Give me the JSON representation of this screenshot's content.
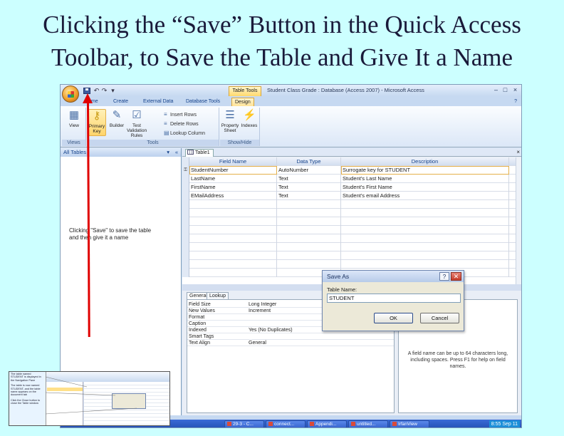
{
  "slide": {
    "title_line1": "Clicking the “Save” Button in the Quick Access",
    "title_line2": "Toolbar, to Save the Table and Give It a Name",
    "annotation": "Clicking \"Save\" to save the table and then give it a name"
  },
  "window": {
    "title": "Student Class Grade : Database (Access 2007) - Microsoft Access",
    "contextual_tab_group": "Table Tools",
    "controls": {
      "minimize": "–",
      "maximize": "□",
      "close": "×"
    },
    "help": "?"
  },
  "ribbon": {
    "tabs": [
      {
        "label": "Home"
      },
      {
        "label": "Create"
      },
      {
        "label": "External Data"
      },
      {
        "label": "Database Tools"
      },
      {
        "label": "Design",
        "active": true
      }
    ],
    "groups": {
      "views": {
        "label": "Views",
        "view_button": "View"
      },
      "tools": {
        "label": "Tools",
        "primary_key": "Primary Key",
        "builder": "Builder",
        "test_validation": "Test Validation Rules",
        "insert_rows": "Insert Rows",
        "delete_rows": "Delete Rows",
        "lookup_column": "Lookup Column"
      },
      "show_hide": {
        "label": "Show/Hide",
        "property_sheet": "Property Sheet",
        "indexes": "Indexes"
      }
    }
  },
  "nav_pane": {
    "header": "All Tables",
    "dropdown": "▾",
    "collapse": "«"
  },
  "document": {
    "tab_label": "Table1",
    "close": "×",
    "columns": [
      "Field Name",
      "Data Type",
      "Description"
    ],
    "rows": [
      {
        "field": "StudentNumber",
        "type": "AutoNumber",
        "desc": "Surrogate key for STUDENT",
        "key": "⚿"
      },
      {
        "field": "LastName",
        "type": "Text",
        "desc": "Student's Last Name"
      },
      {
        "field": "FirstName",
        "type": "Text",
        "desc": "Student's First Name"
      },
      {
        "field": "EMailAddress",
        "type": "Text",
        "desc": "Student's email Address"
      }
    ],
    "field_properties_title": "Field Properties",
    "property_tabs": [
      "General",
      "Lookup"
    ],
    "properties": [
      {
        "k": "Field Size",
        "v": "Long Integer"
      },
      {
        "k": "New Values",
        "v": "Increment"
      },
      {
        "k": "Format",
        "v": ""
      },
      {
        "k": "Caption",
        "v": ""
      },
      {
        "k": "Indexed",
        "v": "Yes (No Duplicates)"
      },
      {
        "k": "Smart Tags",
        "v": ""
      },
      {
        "k": "Text Align",
        "v": "General"
      }
    ],
    "help_text": "A field name can be up to 64 characters long, including spaces. Press F1 for help on field names."
  },
  "dialog": {
    "title": "Save As",
    "help": "?",
    "close": "✕",
    "label": "Table Name:",
    "value": "STUDENT",
    "ok": "OK",
    "cancel": "Cancel"
  },
  "taskbar": {
    "items": [
      "29-3 - C...",
      "connect...",
      "Appendi...",
      "untitled...",
      "IrfanView"
    ],
    "clock": "8:55 Sep 11"
  },
  "thumbnail": {
    "text1": "The table named STUDENT is displayed in the Navigation Pane",
    "text2": "The table is now named STUDENT, and the table name appears on the document tab",
    "text3": "Click the Close button to close the Table window"
  }
}
